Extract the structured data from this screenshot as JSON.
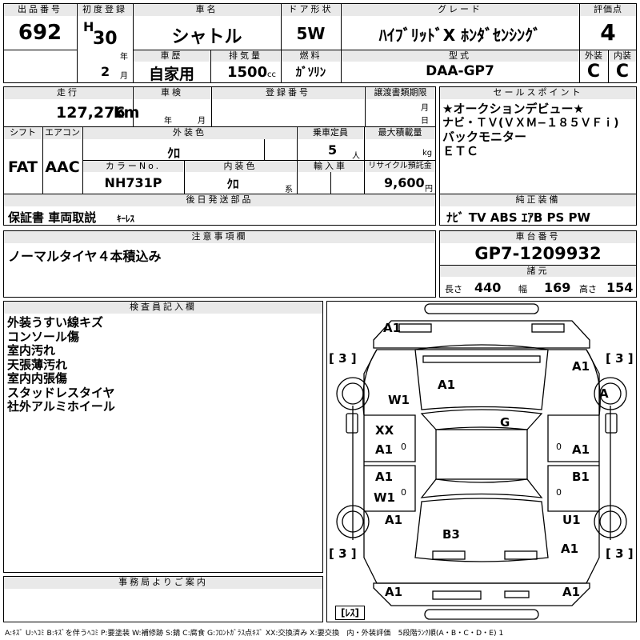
{
  "header": {
    "lot_label": "出品番号",
    "lot": "692",
    "first_reg_label": "初度登録",
    "era": "H",
    "year": "30",
    "year_unit": "年",
    "month": "2",
    "month_unit": "月",
    "name_label": "車名",
    "name": "シャトル",
    "history_label": "車歴",
    "history": "自家用",
    "displacement_label": "排気量",
    "displacement": "1500",
    "displacement_unit": "cc",
    "doors_label": "ドア形状",
    "doors": "5W",
    "fuel_label": "燃料",
    "fuel": "ｶﾞｿﾘﾝ",
    "grade_label": "グレード",
    "grade": "ﾊｲﾌﾞﾘｯﾄﾞX ﾎﾝﾀﾞｾﾝｼﾝｸﾞ",
    "model_label": "型式",
    "model": "DAA-GP7",
    "score_label": "評価点",
    "score": "4",
    "ext_label": "外装",
    "ext": "C",
    "int_label": "内装",
    "int": "C"
  },
  "specs": {
    "mileage_label": "走行",
    "mileage": "127,276",
    "mileage_unit": "km",
    "inspection_label": "車検",
    "year_unit": "年",
    "month_unit": "月",
    "reg_no_label": "登録番号",
    "transfer_label": "譲渡書類期限",
    "day_unit": "日",
    "shift_label": "シフト",
    "shift": "FAT",
    "ac_label": "エアコン",
    "ac": "AAC",
    "ext_color_label": "外装色",
    "ext_color": "ｸﾛ",
    "capacity_label": "乗車定員",
    "capacity": "5",
    "capacity_unit": "人",
    "load_label": "最大積載量",
    "load_unit": "kg",
    "color_no_label": "カラーNo.",
    "color_no": "NH731P",
    "int_color_label": "内装色",
    "int_color": "ｸﾛ",
    "int_color_unit": "系",
    "import_label": "輸入車",
    "recycle_label": "リサイクル預託金",
    "recycle": "9,600",
    "recycle_unit": "円"
  },
  "later_parts": {
    "label": "後日発送部品",
    "value": "保証書 車両取説",
    "extra": "ｷｰﾚｽ"
  },
  "sales_points": {
    "label": "セールスポイント",
    "items": [
      "★オークションデビュー★",
      "ナビ・ＴＶ(ＶＸＭ−１８５ＶＦｉ)",
      "バックモニター",
      "ＥＴＣ"
    ]
  },
  "equipment": {
    "label": "純正装備",
    "value": "ﾅﾋﾞ TV ABS ｴｱB PS PW"
  },
  "notes": {
    "label": "注意事項欄",
    "value": "ノーマルタイヤ４本積込み"
  },
  "chassis": {
    "label": "車台番号",
    "value": "GP7-1209932"
  },
  "dimensions": {
    "label": "諸元",
    "length_label": "長さ",
    "length": "440",
    "width_label": "幅",
    "width": "169",
    "height_label": "高さ",
    "height": "154"
  },
  "inspector": {
    "label": "検査員記入欄",
    "items": [
      "外装うすい線キズ",
      "コンソール傷",
      "室内汚れ",
      "天張薄汚れ",
      "室内内張傷",
      "スタッドレスタイヤ",
      "社外アルミホイール"
    ]
  },
  "office": {
    "label": "事務局よりご案内"
  },
  "diagram": {
    "bracket_tl": "[ 3 ]",
    "bracket_tr": "[ 3 ]",
    "bracket_bl": "[ 3 ]",
    "bracket_br": "[ 3 ]",
    "marks": {
      "front_left": "A1",
      "front_right": "A1",
      "hood": "A1",
      "fender_left": "W1",
      "wheel_right_front": "A",
      "door_left_front": "XX",
      "door_left_front_2": "A1",
      "roof": "G",
      "door_right_front": "A1",
      "door_left_rear": "A1",
      "door_left_rear_2": "W1",
      "door_right_rear": "B1",
      "rear_left": "A1",
      "rear_right": "U1",
      "trunk": "B3",
      "rear_right_2": "A1",
      "bumper_left": "A1",
      "bumper_right": "A1",
      "zero_1": "0",
      "zero_2": "0",
      "zero_3": "0",
      "zero_4": "0"
    },
    "spare": "[ﾚｽ]"
  },
  "legend": "A:ｷｽﾞ U:ﾍｺﾐ B:ｷｽﾞを伴うﾍｺﾐ P:要塗装 W:補修跡 S:錆 C:腐食 G:ﾌﾛﾝﾄｶﾞﾗｽ点ｷｽﾞ XX:交換済み X:要交換　内・外装評価　5段階ﾗﾝｸ順(A・B・C・D・E) 1"
}
